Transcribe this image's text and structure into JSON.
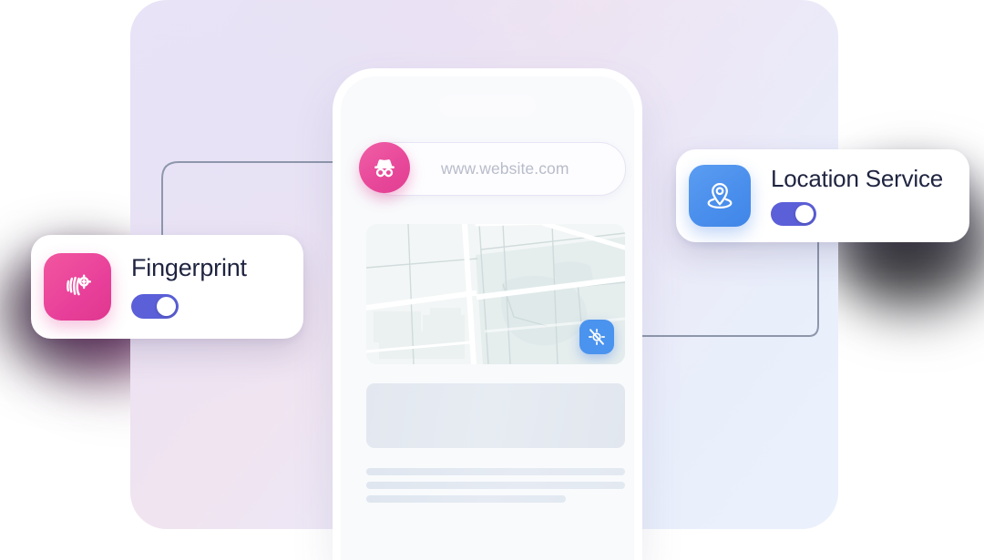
{
  "backdrop": {
    "gradient_from": "#e9e5f7",
    "gradient_to": "#eaf1fc"
  },
  "phone": {
    "notch_label": "phone-notch",
    "browser": {
      "url_value": "www.website.com",
      "url_placeholder": "www.website.com",
      "incognito_icon": "incognito-icon"
    },
    "map": {
      "gps_off_icon": "location-off-icon",
      "gps_off_color": "#4a93ee"
    },
    "skeleton": {
      "hero": "content-placeholder-block",
      "lines": [
        "text-placeholder-line",
        "text-placeholder-line",
        "text-placeholder-line"
      ]
    }
  },
  "cards": [
    {
      "id": "fingerprint",
      "title": "Fingerprint",
      "icon": "fingerprint-icon",
      "icon_color": "#e8409a",
      "toggle_state": "on",
      "toggle_color": "#5b5fd8"
    },
    {
      "id": "location-service",
      "title": "Location Service",
      "icon": "location-pin-icon",
      "icon_color": "#4a8fec",
      "toggle_state": "on",
      "toggle_color": "#5b5fd8"
    }
  ],
  "connectors": {
    "line_color": "#8e97ab",
    "left": "fingerprint-to-incognito-connector",
    "right": "location-service-to-gps-off-connector"
  }
}
